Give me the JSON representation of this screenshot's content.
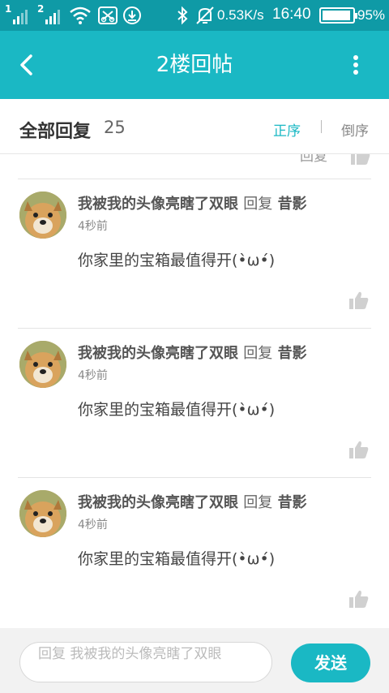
{
  "status_bar": {
    "sim1": "1",
    "sim2": "2",
    "speed": "0.53K/s",
    "time": "16:40",
    "battery_percent": "95%",
    "battery_level": 0.95,
    "icons": [
      "signal-icon",
      "signal-icon",
      "wifi-icon",
      "screenshot-icon",
      "download-icon",
      "bluetooth-icon",
      "mute-bell-icon",
      "battery-icon"
    ]
  },
  "app_bar": {
    "title": "2楼回帖",
    "back_icon": "back-arrow-icon",
    "more_icon": "more-vert-icon"
  },
  "replies_header": {
    "title": "全部回复",
    "count": "25",
    "sort_asc": "正序",
    "sort_desc": "倒序",
    "accent": "#1ab8c4"
  },
  "partial_item": {
    "reply_label": "回复"
  },
  "comments": [
    {
      "user": "我被我的头像亮瞎了双眼",
      "reply_word": "回复",
      "target": "昔影",
      "time": "4秒前",
      "text": "你家里的宝箱最值得开(•̀ω•́)"
    },
    {
      "user": "我被我的头像亮瞎了双眼",
      "reply_word": "回复",
      "target": "昔影",
      "time": "4秒前",
      "text": "你家里的宝箱最值得开(•̀ω•́)"
    },
    {
      "user": "我被我的头像亮瞎了双眼",
      "reply_word": "回复",
      "target": "昔影",
      "time": "4秒前",
      "text": "你家里的宝箱最值得开(•̀ω•́)"
    }
  ],
  "input_bar": {
    "placeholder": "回复 我被我的头像亮瞎了双眼",
    "send_label": "发送"
  }
}
